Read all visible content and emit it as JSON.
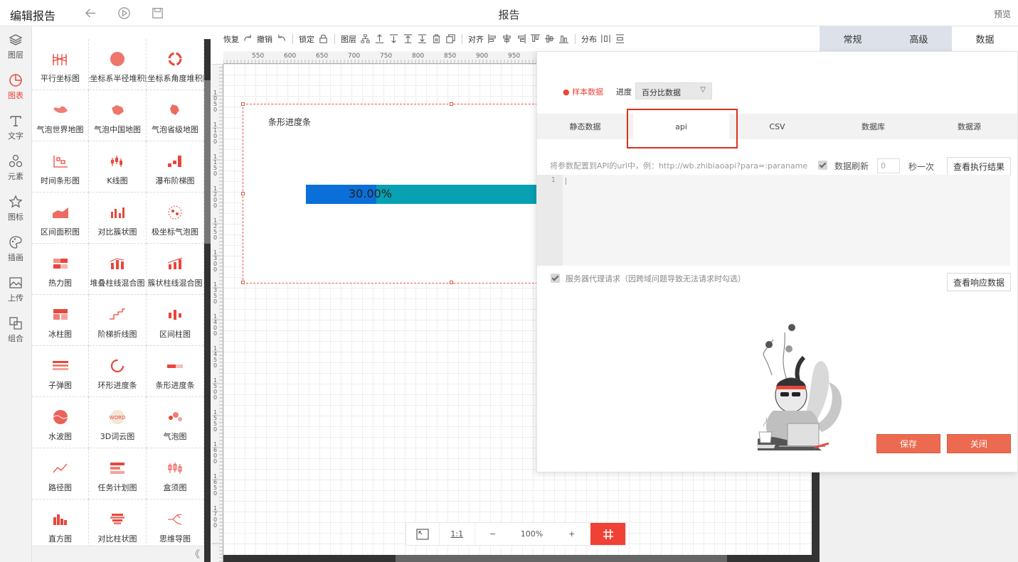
{
  "header": {
    "edit_title": "编辑报告",
    "report_title": "报告",
    "preview": "预览",
    "icons": [
      "undo-icon",
      "play-icon",
      "save-icon"
    ]
  },
  "left_nav": {
    "items": [
      {
        "label": "图层",
        "icon": "layers-icon"
      },
      {
        "label": "图表",
        "icon": "chart-icon",
        "active": true
      },
      {
        "label": "文字",
        "icon": "text-icon"
      },
      {
        "label": "元素",
        "icon": "element-icon"
      },
      {
        "label": "图标",
        "icon": "star-icon"
      },
      {
        "label": "插画",
        "icon": "palette-icon"
      },
      {
        "label": "上传",
        "icon": "upload-image-icon"
      },
      {
        "label": "组合",
        "icon": "group-icon"
      }
    ]
  },
  "palette": {
    "items": [
      {
        "label": "平行坐标图"
      },
      {
        "label": "极坐标系半径堆积图"
      },
      {
        "label": "极坐标系角度堆积图"
      },
      {
        "label": "气泡世界地图"
      },
      {
        "label": "气泡中国地图"
      },
      {
        "label": "气泡省级地图"
      },
      {
        "label": "时间条形图"
      },
      {
        "label": "K线图"
      },
      {
        "label": "瀑布阶梯图"
      },
      {
        "label": "区间面积图"
      },
      {
        "label": "对比簇状图"
      },
      {
        "label": "极坐标气泡图"
      },
      {
        "label": "热力图"
      },
      {
        "label": "堆叠柱线混合图"
      },
      {
        "label": "簇状柱线混合图"
      },
      {
        "label": "冰柱图"
      },
      {
        "label": "阶梯折线图"
      },
      {
        "label": "区间柱图"
      },
      {
        "label": "子弹图"
      },
      {
        "label": "环形进度条"
      },
      {
        "label": "条形进度条"
      },
      {
        "label": "水波图"
      },
      {
        "label": "3D词云图"
      },
      {
        "label": "气泡图"
      },
      {
        "label": "路径图"
      },
      {
        "label": "任务计划图"
      },
      {
        "label": "盒须图"
      },
      {
        "label": "直方图"
      },
      {
        "label": "对比柱状图"
      },
      {
        "label": "思维导图"
      }
    ],
    "collapse": "《"
  },
  "toolbar": {
    "redo": "恢复",
    "undo": "撤销",
    "lock": "锁定",
    "layer": "图层",
    "align": "对齐",
    "distribute": "分布"
  },
  "ruler": {
    "top": [
      "550",
      "600",
      "650",
      "700",
      "750",
      "800",
      "850",
      "900",
      "950"
    ],
    "left": [
      "1050",
      "1100",
      "1150",
      "1200",
      "1250",
      "1300",
      "1350",
      "1400",
      "1450",
      "1500",
      "1550",
      "1600",
      "1650",
      "1700"
    ]
  },
  "component": {
    "title": "条形进度条",
    "percent_text": "30.00%",
    "progress": 0.3
  },
  "zoom": {
    "ratio_label": "1:1",
    "minus": "−",
    "level": "100%",
    "plus": "+"
  },
  "right_tabs": [
    {
      "label": "常规"
    },
    {
      "label": "高级"
    },
    {
      "label": "数据",
      "active": true
    }
  ],
  "dialog": {
    "sample_data": "样本数据",
    "progress_label": "进度",
    "progress_value": "百分比数据",
    "tabs": [
      {
        "label": "静态数据"
      },
      {
        "label": "api",
        "active": true
      },
      {
        "label": "CSV"
      },
      {
        "label": "数据库"
      },
      {
        "label": "数据源"
      }
    ],
    "hint": "将参数配置到API的url中，例：http://wb.zhibiaoapi?para=:paraname",
    "refresh_label": "数据刷新",
    "refresh_value": "0",
    "refresh_unit": "秒一次",
    "view_exec": "查看执行结果",
    "editor_line": "1",
    "proxy_label": "服务器代理请求（因跨域问题导致无法请求时勾选）",
    "view_response": "查看响应数据",
    "save": "保存",
    "close": "关闭"
  },
  "colors": {
    "accent": "#e8473b",
    "progress_fill": "#0a6fd8",
    "progress_track": "#08a0b3",
    "button_red": "#ec6a50"
  }
}
